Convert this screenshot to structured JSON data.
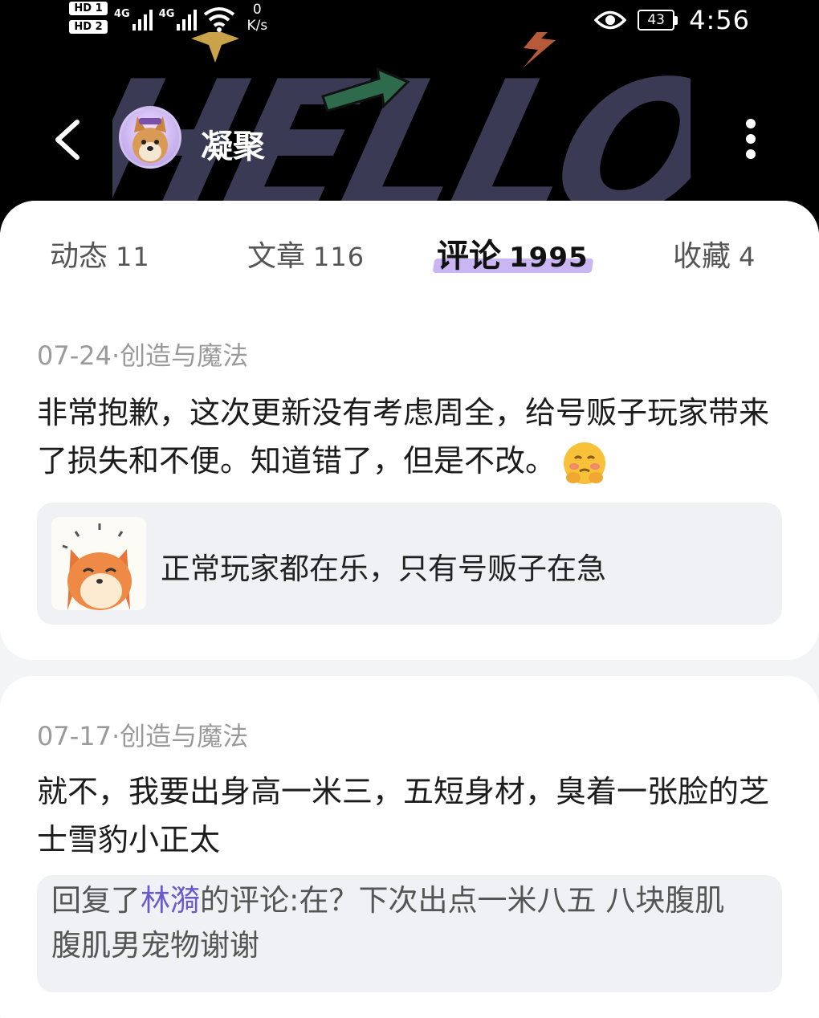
{
  "status_bar": {
    "hd1": "HD 1",
    "hd2": "HD 2",
    "sig1": "4G",
    "sig2": "4G",
    "speed_value": "0",
    "speed_unit": "K/s",
    "battery": "43",
    "time": "4:56"
  },
  "profile": {
    "username": "凝聚",
    "banner_text": "HELLO."
  },
  "tabs": [
    {
      "label": "动态",
      "count": "11"
    },
    {
      "label": "文章",
      "count": "116"
    },
    {
      "label": "评论",
      "count": "1995"
    },
    {
      "label": "收藏",
      "count": "4"
    }
  ],
  "active_tab": "评论",
  "comments": [
    {
      "date": "07-24",
      "source": "创造与魔法",
      "text": "非常抱歉，这次更新没有考虑周全，给号贩子玩家带来了损失和不便。知道错了，但是不改。",
      "quote": "正常玩家都在乐，只有号贩子在急"
    },
    {
      "date": "07-17",
      "source": "创造与魔法",
      "text": "就不，我要出身高一米三，五短身材，臭着一张脸的芝士雪豹小正太",
      "reply_prefix": "回复了",
      "reply_user": "林漪",
      "reply_suffix": "的评论:在？下次出点一米八五 八块腹肌 腹肌男宠物谢谢"
    }
  ],
  "colors": {
    "accent": "#6a5acd",
    "tab_highlight": "#c9b6f3",
    "header_bg": "#000000"
  }
}
